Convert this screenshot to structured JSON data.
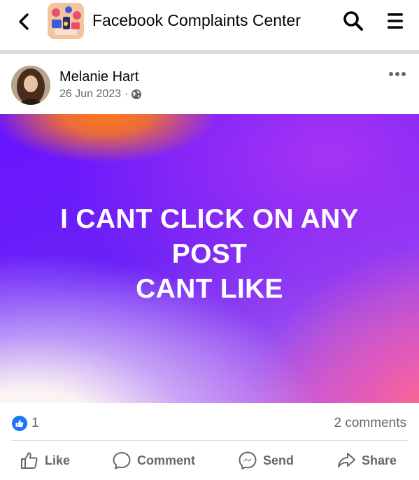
{
  "header": {
    "title": "Facebook Complaints Center",
    "back_icon": "chevron-left-icon",
    "group_icon": "group-photo",
    "search_icon": "search-icon",
    "menu_icon": "hamburger-menu-icon"
  },
  "post": {
    "author": "Melanie Hart",
    "date": "26 Jun 2023",
    "separator": "·",
    "privacy_icon": "globe-icon",
    "more_icon": "more-dots-icon",
    "banner_lines": [
      "I CANT CLICK ON ANY",
      "POST",
      "CANT LIKE"
    ],
    "like_count": "1",
    "comments": "2 comments"
  },
  "actions": {
    "like": "Like",
    "comment": "Comment",
    "send": "Send",
    "share": "Share"
  },
  "colors": {
    "accent_blue": "#1877f2",
    "muted_text": "#65676b",
    "banner_purple": "#6a13ff",
    "banner_orange": "#ff7a1a"
  }
}
